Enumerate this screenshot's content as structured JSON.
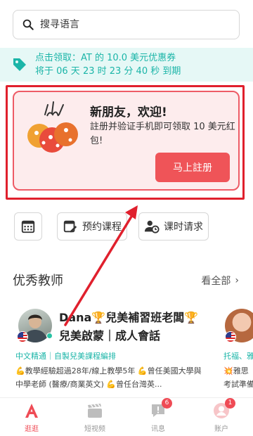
{
  "search": {
    "placeholder": "搜寻语言"
  },
  "coupon": {
    "line1": "点击领取：AT 的 10.0 美元优惠券",
    "line2": "将于 06 天 23 时 23 分 40 秒 到期"
  },
  "welcome": {
    "title": "新朋友，欢迎!",
    "desc": "註册并验证手机即可领取 10 美元红包!",
    "button": "马上註册"
  },
  "quick_actions": {
    "book_label": "预约课程",
    "request_label": "课时请求"
  },
  "teachers": {
    "section_title": "优秀教师",
    "see_all": "看全部",
    "cards": [
      {
        "name": "Dana🏆兒美補習班老闆🏆兒美啟蒙｜成人會話",
        "tags": "中文精通｜自製兒美課程編排",
        "bio": "💪教學經驗超過28年/線上教學5年 💪曾任美國大學與中學老師 (醫療/商業英文) 💪曾任台灣英..."
      },
      {
        "tags": "托福、雅思",
        "bio_line1": "💥雅思",
        "bio_line2": "考試準備"
      }
    ]
  },
  "tabbar": {
    "items": [
      {
        "label": "逛逛",
        "badge": ""
      },
      {
        "label": "短视频",
        "badge": ""
      },
      {
        "label": "讯息",
        "badge": "6"
      },
      {
        "label": "账户",
        "badge": "1"
      }
    ]
  },
  "colors": {
    "accent": "#ef4b55",
    "teal": "#1bb5a8",
    "annotation_red": "#e0202d"
  }
}
